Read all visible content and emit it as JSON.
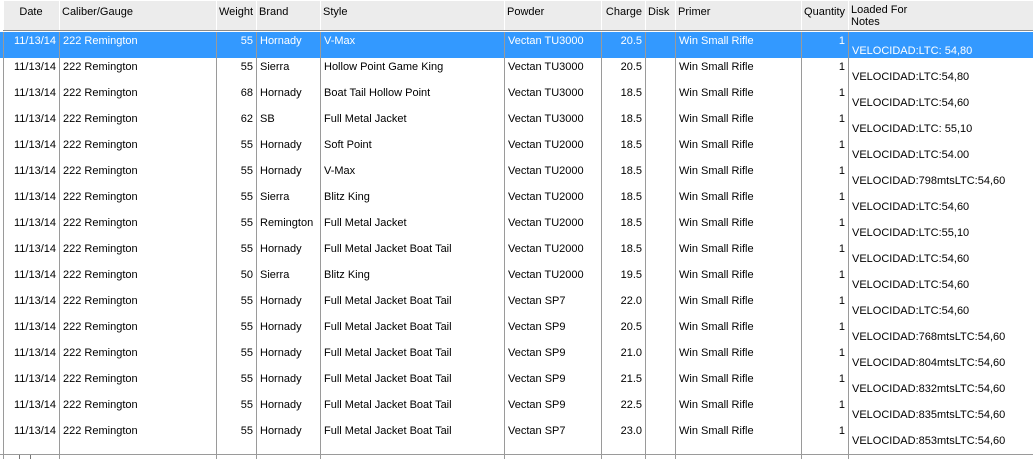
{
  "columns": [
    {
      "key": "date",
      "label": "Date"
    },
    {
      "key": "caliber",
      "label": "Caliber/Gauge"
    },
    {
      "key": "weight",
      "label": "Weight"
    },
    {
      "key": "brand",
      "label": "Brand"
    },
    {
      "key": "style",
      "label": "Style"
    },
    {
      "key": "powder",
      "label": "Powder"
    },
    {
      "key": "charge",
      "label": "Charge"
    },
    {
      "key": "disk",
      "label": "Disk"
    },
    {
      "key": "primer",
      "label": "Primer"
    },
    {
      "key": "quantity",
      "label": "Quantity"
    },
    {
      "key": "notes",
      "label": "Loaded For\nNotes"
    }
  ],
  "rows": [
    {
      "date": "11/13/14",
      "caliber": "222 Remington",
      "weight": "55",
      "brand": "Hornady",
      "style": "V-Max",
      "powder": "Vectan TU3000",
      "charge": "20.5",
      "disk": "",
      "primer": "Win Small Rifle",
      "quantity": "1",
      "notes": "VELOCIDAD:LTC: 54,80",
      "selected": true
    },
    {
      "date": "11/13/14",
      "caliber": "222 Remington",
      "weight": "55",
      "brand": "Sierra",
      "style": "Hollow Point Game King",
      "powder": "Vectan TU3000",
      "charge": "20.5",
      "disk": "",
      "primer": "Win Small Rifle",
      "quantity": "1",
      "notes": "VELOCIDAD:LTC:54,80"
    },
    {
      "date": "11/13/14",
      "caliber": "222 Remington",
      "weight": "68",
      "brand": "Hornady",
      "style": "Boat Tail Hollow Point",
      "powder": "Vectan TU3000",
      "charge": "18.5",
      "disk": "",
      "primer": "Win Small Rifle",
      "quantity": "1",
      "notes": "VELOCIDAD:LTC:54,60"
    },
    {
      "date": "11/13/14",
      "caliber": "222 Remington",
      "weight": "62",
      "brand": "SB",
      "style": "Full Metal Jacket",
      "powder": "Vectan TU3000",
      "charge": "18.5",
      "disk": "",
      "primer": "Win Small Rifle",
      "quantity": "1",
      "notes": "VELOCIDAD:LTC: 55,10"
    },
    {
      "date": "11/13/14",
      "caliber": "222 Remington",
      "weight": "55",
      "brand": "Hornady",
      "style": "Soft Point",
      "powder": "Vectan TU2000",
      "charge": "18.5",
      "disk": "",
      "primer": "Win Small Rifle",
      "quantity": "1",
      "notes": "VELOCIDAD:LTC:54.00"
    },
    {
      "date": "11/13/14",
      "caliber": "222 Remington",
      "weight": "55",
      "brand": "Hornady",
      "style": "V-Max",
      "powder": "Vectan TU2000",
      "charge": "18.5",
      "disk": "",
      "primer": "Win Small Rifle",
      "quantity": "1",
      "notes": "VELOCIDAD:798mtsLTC:54,60"
    },
    {
      "date": "11/13/14",
      "caliber": "222 Remington",
      "weight": "55",
      "brand": "Sierra",
      "style": "Blitz King",
      "powder": "Vectan TU2000",
      "charge": "18.5",
      "disk": "",
      "primer": "Win Small Rifle",
      "quantity": "1",
      "notes": "VELOCIDAD:LTC:54,60"
    },
    {
      "date": "11/13/14",
      "caliber": "222 Remington",
      "weight": "55",
      "brand": "Remington",
      "style": "Full Metal Jacket",
      "powder": "Vectan TU2000",
      "charge": "18.5",
      "disk": "",
      "primer": "Win Small Rifle",
      "quantity": "1",
      "notes": "VELOCIDAD:LTC:55,10"
    },
    {
      "date": "11/13/14",
      "caliber": "222 Remington",
      "weight": "55",
      "brand": "Hornady",
      "style": "Full Metal Jacket Boat Tail",
      "powder": "Vectan TU2000",
      "charge": "18.5",
      "disk": "",
      "primer": "Win Small Rifle",
      "quantity": "1",
      "notes": "VELOCIDAD:LTC:54,60"
    },
    {
      "date": "11/13/14",
      "caliber": "222 Remington",
      "weight": "50",
      "brand": "Sierra",
      "style": "Blitz King",
      "powder": "Vectan TU2000",
      "charge": "19.5",
      "disk": "",
      "primer": "Win Small Rifle",
      "quantity": "1",
      "notes": "VELOCIDAD:LTC:54,60"
    },
    {
      "date": "11/13/14",
      "caliber": "222 Remington",
      "weight": "55",
      "brand": "Hornady",
      "style": "Full Metal Jacket Boat Tail",
      "powder": "Vectan SP7",
      "charge": "22.0",
      "disk": "",
      "primer": "Win Small Rifle",
      "quantity": "1",
      "notes": "VELOCIDAD:LTC:54,60"
    },
    {
      "date": "11/13/14",
      "caliber": "222 Remington",
      "weight": "55",
      "brand": "Hornady",
      "style": "Full Metal Jacket Boat Tail",
      "powder": "Vectan SP9",
      "charge": "20.5",
      "disk": "",
      "primer": "Win Small Rifle",
      "quantity": "1",
      "notes": "VELOCIDAD:768mtsLTC:54,60"
    },
    {
      "date": "11/13/14",
      "caliber": "222 Remington",
      "weight": "55",
      "brand": "Hornady",
      "style": "Full Metal Jacket Boat Tail",
      "powder": "Vectan SP9",
      "charge": "21.0",
      "disk": "",
      "primer": "Win Small Rifle",
      "quantity": "1",
      "notes": "VELOCIDAD:804mtsLTC:54,60"
    },
    {
      "date": "11/13/14",
      "caliber": "222 Remington",
      "weight": "55",
      "brand": "Hornady",
      "style": "Full Metal Jacket Boat Tail",
      "powder": "Vectan SP9",
      "charge": "21.5",
      "disk": "",
      "primer": "Win Small Rifle",
      "quantity": "1",
      "notes": "VELOCIDAD:832mtsLTC:54,60"
    },
    {
      "date": "11/13/14",
      "caliber": "222 Remington",
      "weight": "55",
      "brand": "Hornady",
      "style": "Full Metal Jacket Boat Tail",
      "powder": "Vectan SP9",
      "charge": "22.5",
      "disk": "",
      "primer": "Win Small Rifle",
      "quantity": "1",
      "notes": "VELOCIDAD:835mtsLTC:54,60"
    },
    {
      "date": "11/13/14",
      "caliber": "222 Remington",
      "weight": "55",
      "brand": "Hornady",
      "style": "Full Metal Jacket Boat Tail",
      "powder": "Vectan SP7",
      "charge": "23.0",
      "disk": "",
      "primer": "Win Small Rifle",
      "quantity": "1",
      "notes": "VELOCIDAD:853mtsLTC:54,60"
    }
  ],
  "colors": {
    "selection": "#3399ff",
    "header_bg": "#ececec",
    "grid_line": "#9a9a9a"
  }
}
